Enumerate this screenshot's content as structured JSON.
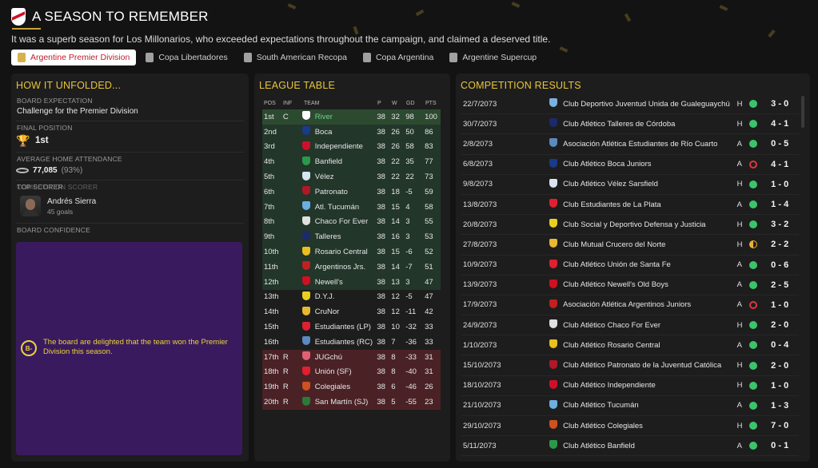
{
  "header": {
    "title": "A SEASON TO REMEMBER",
    "subtitle": "It was a superb season for Los Millonarios, who exceeded expectations throughout the campaign, and claimed a deserved title.",
    "accent": "#c9a43a",
    "tabs": [
      {
        "label": "Argentine Premier Division",
        "icon": "trophy-icon",
        "active": true
      },
      {
        "label": "Copa Libertadores",
        "icon": "trophy-icon",
        "active": false
      },
      {
        "label": "South American Recopa",
        "icon": "trophy-icon",
        "active": false
      },
      {
        "label": "Copa Argentina",
        "icon": "trophy-icon",
        "active": false
      },
      {
        "label": "Argentine Supercup",
        "icon": "trophy-icon",
        "active": false
      }
    ]
  },
  "unfolded": {
    "title": "HOW IT UNFOLDED...",
    "board_expectation_label": "BOARD EXPECTATION",
    "board_expectation": "Challenge for the Premier Division",
    "final_position_label": "FINAL POSITION",
    "final_position": "1st",
    "attendance_label": "AVERAGE HOME ATTENDANCE",
    "attendance": "77,085",
    "attendance_pct": "(93%)",
    "scorer_label": "TOP SCORER",
    "scorer_overlap_label": "COMPETITION SCORER",
    "scorer_name": "Andrés Sierra",
    "scorer_goals": "45 goals",
    "confidence_label": "BOARD CONFIDENCE",
    "confidence_grade": "B-",
    "confidence_text": "The board are delighted that the team won the Premier Division this season.",
    "confidence_color": "#3a1a5e"
  },
  "league": {
    "title": "LEAGUE TABLE",
    "headers": {
      "pos": "POS",
      "inf": "INF",
      "team": "TEAM",
      "p": "P",
      "w": "W",
      "gd": "GD",
      "pts": "PTS"
    },
    "rows": [
      {
        "pos": "1st",
        "inf": "C",
        "team": "River",
        "p": "38",
        "w": "32",
        "gd": "98",
        "pts": "100",
        "zone": "champ",
        "crest": "#ffffff"
      },
      {
        "pos": "2nd",
        "inf": "",
        "team": "Boca",
        "p": "38",
        "w": "26",
        "gd": "50",
        "pts": "86",
        "zone": "green",
        "crest": "#1a3a8a"
      },
      {
        "pos": "3rd",
        "inf": "",
        "team": "Independiente",
        "p": "38",
        "w": "26",
        "gd": "58",
        "pts": "83",
        "zone": "green",
        "crest": "#d0102a"
      },
      {
        "pos": "4th",
        "inf": "",
        "team": "Banfield",
        "p": "38",
        "w": "22",
        "gd": "35",
        "pts": "77",
        "zone": "green",
        "crest": "#2a9a4a"
      },
      {
        "pos": "5th",
        "inf": "",
        "team": "Vélez",
        "p": "38",
        "w": "22",
        "gd": "22",
        "pts": "73",
        "zone": "green",
        "crest": "#d8e4f0"
      },
      {
        "pos": "6th",
        "inf": "",
        "team": "Patronato",
        "p": "38",
        "w": "18",
        "gd": "-5",
        "pts": "59",
        "zone": "green",
        "crest": "#b01828"
      },
      {
        "pos": "7th",
        "inf": "",
        "team": "Atl. Tucumán",
        "p": "38",
        "w": "15",
        "gd": "4",
        "pts": "58",
        "zone": "green",
        "crest": "#6ab0e0"
      },
      {
        "pos": "8th",
        "inf": "",
        "team": "Chaco For Ever",
        "p": "38",
        "w": "14",
        "gd": "3",
        "pts": "55",
        "zone": "green",
        "crest": "#e0e0e0"
      },
      {
        "pos": "9th",
        "inf": "",
        "team": "Talleres",
        "p": "38",
        "w": "16",
        "gd": "3",
        "pts": "53",
        "zone": "green",
        "crest": "#1a2a6a"
      },
      {
        "pos": "10th",
        "inf": "",
        "team": "Rosario Central",
        "p": "38",
        "w": "15",
        "gd": "-6",
        "pts": "52",
        "zone": "green",
        "crest": "#e8c020"
      },
      {
        "pos": "11th",
        "inf": "",
        "team": "Argentinos Jrs.",
        "p": "38",
        "w": "14",
        "gd": "-7",
        "pts": "51",
        "zone": "green",
        "crest": "#c02020"
      },
      {
        "pos": "12th",
        "inf": "",
        "team": "Newell's",
        "p": "38",
        "w": "13",
        "gd": "3",
        "pts": "47",
        "zone": "green",
        "crest": "#d01020"
      },
      {
        "pos": "13th",
        "inf": "",
        "team": "D.Y.J.",
        "p": "38",
        "w": "12",
        "gd": "-5",
        "pts": "47",
        "zone": "none",
        "crest": "#e8d020"
      },
      {
        "pos": "14th",
        "inf": "",
        "team": "CruNor",
        "p": "38",
        "w": "12",
        "gd": "-11",
        "pts": "42",
        "zone": "none",
        "crest": "#e8b830"
      },
      {
        "pos": "15th",
        "inf": "",
        "team": "Estudiantes (LP)",
        "p": "38",
        "w": "10",
        "gd": "-32",
        "pts": "33",
        "zone": "none",
        "crest": "#e02030"
      },
      {
        "pos": "16th",
        "inf": "",
        "team": "Estudiantes (RC)",
        "p": "38",
        "w": "7",
        "gd": "-36",
        "pts": "33",
        "zone": "none",
        "crest": "#5a8ac0"
      },
      {
        "pos": "17th",
        "inf": "R",
        "team": "JUGchú",
        "p": "38",
        "w": "8",
        "gd": "-33",
        "pts": "31",
        "zone": "rel",
        "crest": "#e06070"
      },
      {
        "pos": "18th",
        "inf": "R",
        "team": "Unión (SF)",
        "p": "38",
        "w": "8",
        "gd": "-40",
        "pts": "31",
        "zone": "rel",
        "crest": "#e02030"
      },
      {
        "pos": "19th",
        "inf": "R",
        "team": "Colegiales",
        "p": "38",
        "w": "6",
        "gd": "-46",
        "pts": "26",
        "zone": "rel",
        "crest": "#d05020"
      },
      {
        "pos": "20th",
        "inf": "R",
        "team": "San Martín (SJ)",
        "p": "38",
        "w": "5",
        "gd": "-55",
        "pts": "23",
        "zone": "rel",
        "crest": "#2a7a3a"
      }
    ]
  },
  "results": {
    "title": "COMPETITION RESULTS",
    "rows": [
      {
        "date": "22/7/2073",
        "opponent": "Club Deportivo Juventud Unida de Gualeguaychú",
        "ha": "H",
        "outcome": "win",
        "score": "3 - 0",
        "crest": "#7ab0e0"
      },
      {
        "date": "30/7/2073",
        "opponent": "Club Atlético Talleres de Córdoba",
        "ha": "H",
        "outcome": "win",
        "score": "4 - 1",
        "crest": "#1a2a6a"
      },
      {
        "date": "2/8/2073",
        "opponent": "Asociación Atlética Estudiantes de Río Cuarto",
        "ha": "A",
        "outcome": "win",
        "score": "0 - 5",
        "crest": "#5a8ac0"
      },
      {
        "date": "6/8/2073",
        "opponent": "Club Atlético Boca Juniors",
        "ha": "A",
        "outcome": "loss",
        "score": "4 - 1",
        "crest": "#1a3a8a"
      },
      {
        "date": "9/8/2073",
        "opponent": "Club Atlético Vélez Sarsfield",
        "ha": "H",
        "outcome": "win",
        "score": "1 - 0",
        "crest": "#d8e4f0"
      },
      {
        "date": "13/8/2073",
        "opponent": "Club Estudiantes de La Plata",
        "ha": "A",
        "outcome": "win",
        "score": "1 - 4",
        "crest": "#e02030"
      },
      {
        "date": "20/8/2073",
        "opponent": "Club Social y Deportivo Defensa y Justicia",
        "ha": "H",
        "outcome": "win",
        "score": "3 - 2",
        "crest": "#e8d020"
      },
      {
        "date": "27/8/2073",
        "opponent": "Club Mutual Crucero del Norte",
        "ha": "H",
        "outcome": "draw",
        "score": "2 - 2",
        "crest": "#e8b830"
      },
      {
        "date": "10/9/2073",
        "opponent": "Club Atlético Unión de Santa Fe",
        "ha": "A",
        "outcome": "win",
        "score": "0 - 6",
        "crest": "#e02030"
      },
      {
        "date": "13/9/2073",
        "opponent": "Club Atlético Newell's Old Boys",
        "ha": "A",
        "outcome": "win",
        "score": "2 - 5",
        "crest": "#d01020"
      },
      {
        "date": "17/9/2073",
        "opponent": "Asociación Atlética Argentinos Juniors",
        "ha": "A",
        "outcome": "loss",
        "score": "1 - 0",
        "crest": "#c02020"
      },
      {
        "date": "24/9/2073",
        "opponent": "Club Atlético Chaco For Ever",
        "ha": "H",
        "outcome": "win",
        "score": "2 - 0",
        "crest": "#e0e0e0"
      },
      {
        "date": "1/10/2073",
        "opponent": "Club Atlético Rosario Central",
        "ha": "A",
        "outcome": "win",
        "score": "0 - 4",
        "crest": "#e8c020"
      },
      {
        "date": "15/10/2073",
        "opponent": "Club Atlético Patronato de la Juventud Católica",
        "ha": "H",
        "outcome": "win",
        "score": "2 - 0",
        "crest": "#b01828"
      },
      {
        "date": "18/10/2073",
        "opponent": "Club Atlético Independiente",
        "ha": "H",
        "outcome": "win",
        "score": "1 - 0",
        "crest": "#d0102a"
      },
      {
        "date": "21/10/2073",
        "opponent": "Club Atlético Tucumán",
        "ha": "A",
        "outcome": "win",
        "score": "1 - 3",
        "crest": "#6ab0e0"
      },
      {
        "date": "29/10/2073",
        "opponent": "Club Atlético Colegiales",
        "ha": "H",
        "outcome": "win",
        "score": "7 - 0",
        "crest": "#d05020"
      },
      {
        "date": "5/11/2073",
        "opponent": "Club Atlético Banfield",
        "ha": "A",
        "outcome": "win",
        "score": "0 - 1",
        "crest": "#2a9a4a"
      }
    ]
  }
}
